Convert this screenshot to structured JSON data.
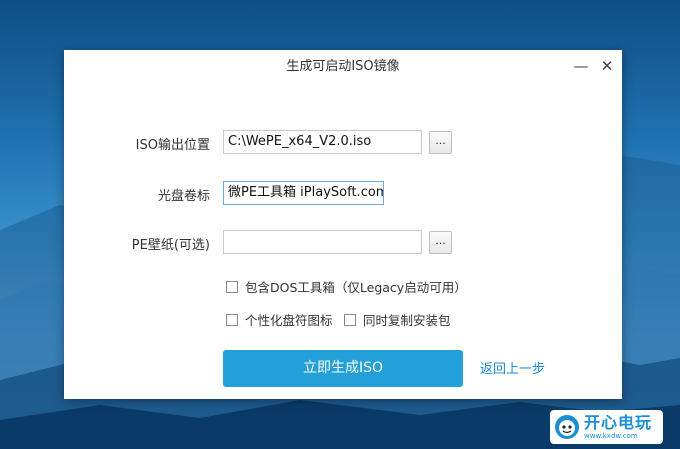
{
  "window": {
    "title": "生成可启动ISO镜像",
    "minimize_glyph": "—",
    "close_glyph": "✕"
  },
  "form": {
    "iso_output": {
      "label": "ISO输出位置",
      "value": "C:\\WePE_x64_V2.0.iso",
      "browse_label": "..."
    },
    "volume_label": {
      "label": "光盘卷标",
      "value": "微PE工具箱 iPlaySoft.com"
    },
    "wallpaper": {
      "label": "PE壁纸(可选)",
      "value": "",
      "browse_label": "..."
    }
  },
  "options": {
    "include_dos": {
      "label": "包含DOS工具箱（仅Legacy启动可用）",
      "checked": false
    },
    "personalize_icon": {
      "label": "个性化盘符图标",
      "checked": false
    },
    "copy_installer": {
      "label": "同时复制安装包",
      "checked": false
    }
  },
  "actions": {
    "generate_label": "立即生成ISO",
    "back_label": "返回上一步"
  },
  "watermark": {
    "main": "开心电玩",
    "sub": "www.kxdw.com"
  },
  "colors": {
    "primary_button": "#23a0d8",
    "link": "#1e88d2",
    "focus_border": "#6aa9e6"
  },
  "icons": [
    "minimize-icon",
    "close-icon",
    "folder-browse-icon",
    "checkbox-icon",
    "mascot-icon"
  ]
}
